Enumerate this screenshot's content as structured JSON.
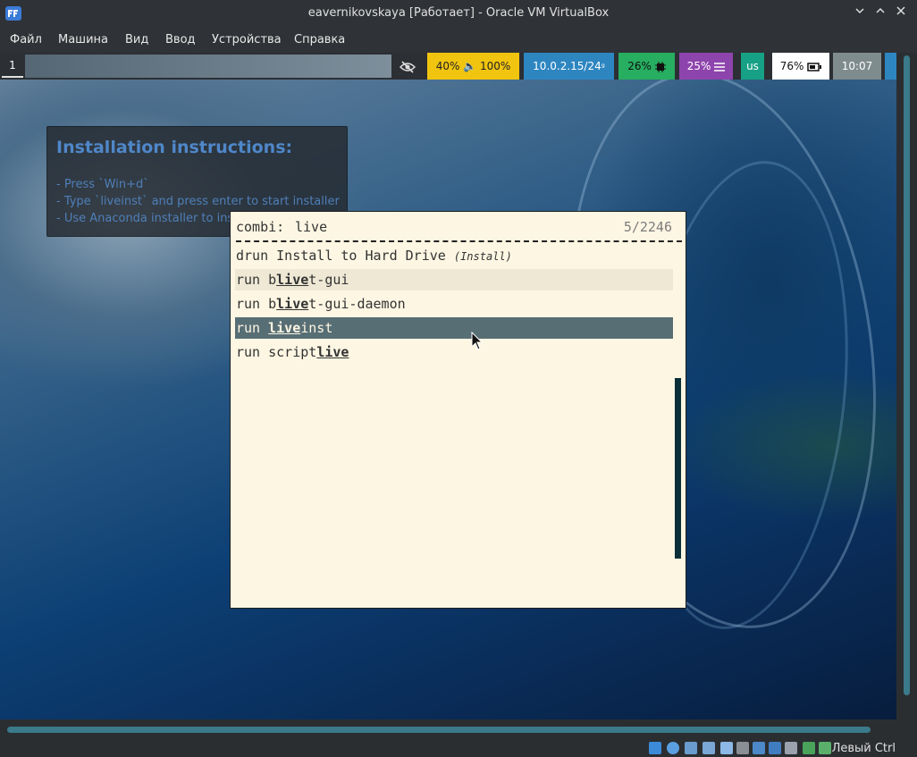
{
  "window": {
    "title": "eavernikovskaya [Работает] - Oracle VM VirtualBox",
    "controls": [
      "minimize",
      "maximize",
      "close"
    ]
  },
  "menu": [
    "Файл",
    "Машина",
    "Вид",
    "Ввод",
    "Устройства",
    "Справка"
  ],
  "bar": {
    "workspace": "1",
    "segments": {
      "privacy_icon": "eye-slash-icon",
      "audio": "40% 🔈 100%",
      "network": "10.0.2.15/24",
      "network_suffix": "ᵍ",
      "cpu": "26%",
      "memory": "25%",
      "layout": "us",
      "battery": "76%",
      "time": "10:07"
    },
    "colors": {
      "audio": "#f1c40f",
      "network": "#2e86c1",
      "cpu": "#27ae60",
      "memory": "#8e44ad",
      "layout": "#16a085",
      "battery": "#ffffff",
      "time": "#7f8c8d"
    }
  },
  "note": {
    "title": "Installation instructions:",
    "lines": [
      "- Press `Win+d`",
      "- Type `liveinst` and press enter to start installer",
      "- Use Anaconda installer to ins"
    ]
  },
  "rofi": {
    "prompt": "combi:",
    "query": "live",
    "count": "5/2246",
    "items": [
      {
        "pre": "drun Install to Hard Drive ",
        "match": "",
        "post": "",
        "hint": "(Install)"
      },
      {
        "pre": "run b",
        "match": "live",
        "post": "t-gui",
        "hint": ""
      },
      {
        "pre": "run b",
        "match": "live",
        "post": "t-gui-daemon",
        "hint": ""
      },
      {
        "pre": "run ",
        "match": "live",
        "post": "inst",
        "hint": ""
      },
      {
        "pre": "run script",
        "match": "live",
        "post": "",
        "hint": ""
      }
    ],
    "colors": {
      "background": "#fdf6e3",
      "alternate": "#eee8d5",
      "selected": "#586e75"
    }
  },
  "statusbar": {
    "host_key": "Левый Ctrl",
    "icons": [
      "storage-icon",
      "optical-icon",
      "network-icon",
      "usb-icon",
      "shared-folder-icon",
      "display-icon",
      "recording-icon",
      "mouse-integration-icon",
      "cpu-icon",
      "status-icon"
    ]
  }
}
